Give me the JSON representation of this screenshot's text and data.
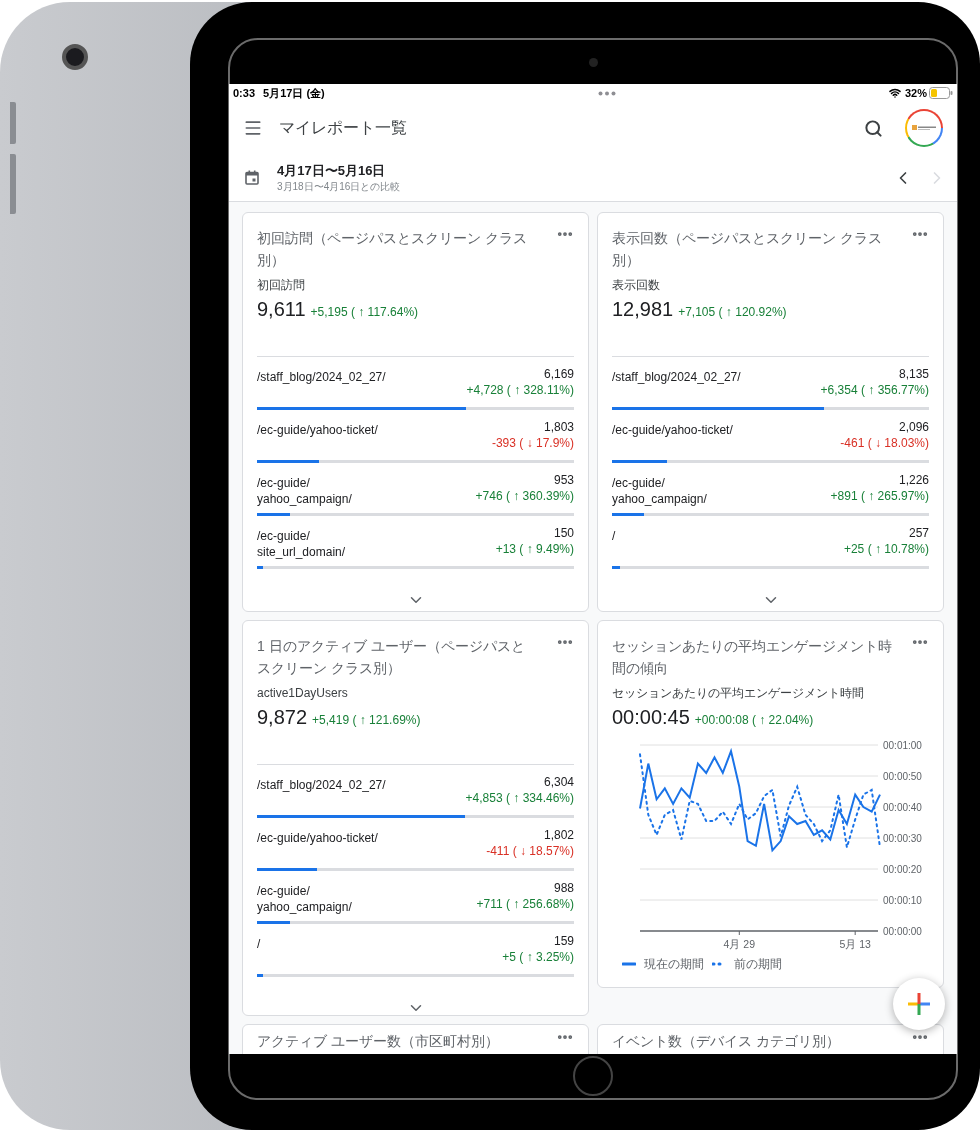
{
  "status_bar": {
    "time": "0:33",
    "date": "5月17日 (金)",
    "battery": "32%"
  },
  "app_bar": {
    "title": "マイレポート一覧"
  },
  "date_range": {
    "range": "4月17日〜5月16日",
    "comparison": "3月18日〜4月16日との比較",
    "prev_disabled": false,
    "next_disabled": true
  },
  "cards": [
    {
      "kind": "table",
      "title": "初回訪問（ページパスとスクリーン クラス別）",
      "metric_label": "初回訪問",
      "value": "9,611",
      "change": "+5,195 ( ↑ 117.64%)",
      "color": "#188038",
      "rows": [
        {
          "path": "/staff_blog/2024_02_27/",
          "value": "6,169",
          "change": "+4,728 ( ↑ 328.11%)",
          "color": "#188038",
          "level": 0.66
        },
        {
          "path": "/ec-guide/yahoo-ticket/",
          "value": "1,803",
          "change": "-393 ( ↓ 17.9%)",
          "color": "#d93025",
          "level": 0.195
        },
        {
          "path": "/ec-guide/yahoo_campaign/",
          "value": "953",
          "change": "+746 ( ↑ 360.39%)",
          "color": "#188038",
          "level": 0.105
        },
        {
          "path": "/ec-guide/site_url_domain/",
          "value": "150",
          "change": "+13 ( ↑ 9.49%)",
          "color": "#188038",
          "level": 0.02
        }
      ]
    },
    {
      "kind": "table",
      "title": "表示回数（ページパスとスクリーン クラス別）",
      "metric_label": "表示回数",
      "value": "12,981",
      "change": "+7,105 ( ↑ 120.92%)",
      "color": "#188038",
      "rows": [
        {
          "path": "/staff_blog/2024_02_27/",
          "value": "8,135",
          "change": "+6,354 ( ↑ 356.77%)",
          "color": "#188038",
          "level": 0.67
        },
        {
          "path": "/ec-guide/yahoo-ticket/",
          "value": "2,096",
          "change": "-461 ( ↓ 18.03%)",
          "color": "#d93025",
          "level": 0.175
        },
        {
          "path": "/ec-guide/yahoo_campaign/",
          "value": "1,226",
          "change": "+891 ( ↑ 265.97%)",
          "color": "#188038",
          "level": 0.1
        },
        {
          "path": "/",
          "value": "257",
          "change": "+25 ( ↑ 10.78%)",
          "color": "#188038",
          "level": 0.025
        }
      ]
    },
    {
      "kind": "table",
      "title": "1 日のアクティブ ユーザー（ページパスとスクリーン クラス別）",
      "metric_label": "active1DayUsers",
      "value": "9,872",
      "change": "+5,419 ( ↑ 121.69%)",
      "color": "#188038",
      "rows": [
        {
          "path": "/staff_blog/2024_02_27/",
          "value": "6,304",
          "change": "+4,853 ( ↑ 334.46%)",
          "color": "#188038",
          "level": 0.655
        },
        {
          "path": "/ec-guide/yahoo-ticket/",
          "value": "1,802",
          "change": "-411 ( ↓ 18.57%)",
          "color": "#d93025",
          "level": 0.19
        },
        {
          "path": "/ec-guide/yahoo_campaign/",
          "value": "988",
          "change": "+711 ( ↑ 256.68%)",
          "color": "#188038",
          "level": 0.105
        },
        {
          "path": "/",
          "value": "159",
          "change": "+5 ( ↑ 3.25%)",
          "color": "#188038",
          "level": 0.02
        }
      ]
    },
    {
      "kind": "chart",
      "title": "セッションあたりの平均エンゲージメント時間の傾向",
      "metric_label": "セッションあたりの平均エンゲージメント時間",
      "value": "00:00:45",
      "change": "+00:00:08 ( ↑ 22.04%)",
      "color": "#188038",
      "chart_data": {
        "type": "line",
        "categories": [
          null,
          null,
          null,
          null,
          null,
          null,
          null,
          null,
          null,
          null,
          null,
          null,
          "4月 29",
          null,
          null,
          null,
          null,
          null,
          null,
          null,
          null,
          null,
          null,
          null,
          null,
          null,
          "5月 13",
          null,
          null,
          null
        ],
        "ylim": [
          0,
          60
        ],
        "grid": true,
        "legend": "bottom",
        "yticks": [
          {
            "value": 0,
            "label": "00:00:00"
          },
          {
            "value": 10,
            "label": "00:00:10"
          },
          {
            "value": 20,
            "label": "00:00:20"
          },
          {
            "value": 30,
            "label": "00:00:30"
          },
          {
            "value": 40,
            "label": "00:00:40"
          },
          {
            "value": 50,
            "label": "00:00:50"
          },
          {
            "value": 60,
            "label": "00:01:00"
          }
        ],
        "series": [
          {
            "name": "現在の期間",
            "color": "#1a73e8",
            "line_style": "solid",
            "values": [
              39.5,
              54,
              42.5,
              46,
              41,
              46,
              43,
              54,
              51,
              56,
              51,
              58,
              46.5,
              29,
              27.5,
              41,
              26,
              29,
              37,
              34.5,
              35.5,
              31,
              32.5,
              29.5,
              39,
              34.5,
              44,
              40,
              38.5,
              44
            ]
          },
          {
            "name": "前の期間",
            "color": "#1a73e8",
            "line_style": "dotted",
            "values": [
              57,
              37.5,
              31,
              37.5,
              39,
              29.5,
              42,
              41,
              35.5,
              35.5,
              38.5,
              34.5,
              41,
              36,
              38,
              43.5,
              45.5,
              30.5,
              40.5,
              46.5,
              37.5,
              34.5,
              29,
              32.5,
              44,
              27,
              36,
              44,
              45.5,
              27
            ]
          }
        ]
      }
    },
    {
      "kind": "partial",
      "title": "アクティブ ユーザー数（市区町村別）"
    },
    {
      "kind": "partial",
      "title": "イベント数（デバイス カテゴリ別）"
    }
  ]
}
